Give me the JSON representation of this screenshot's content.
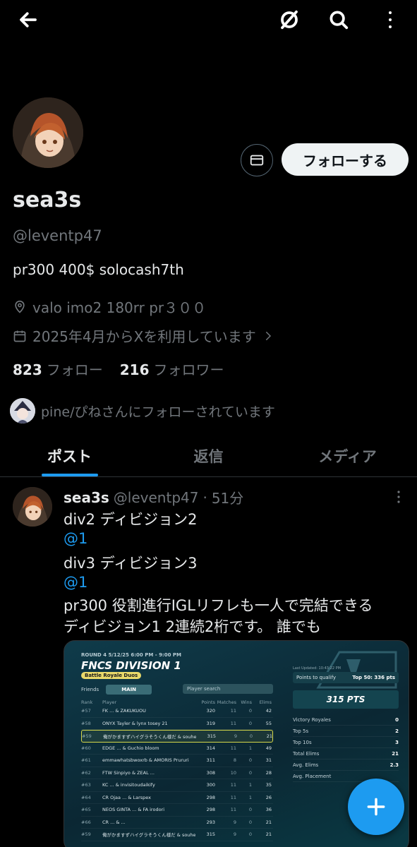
{
  "topbar": {
    "back_icon": "arrow-left-icon",
    "grok_icon": "grok-icon",
    "search_icon": "search-icon",
    "more_icon": "more-vertical-icon"
  },
  "profile": {
    "name": "sea3s",
    "handle": "@leventp47",
    "bio": "pr300 400$ solocash7th",
    "location": "valo imo2 180rr pr３００",
    "joined": "2025年4月からXを利用しています",
    "following_count": "823",
    "following_label": "フォロー",
    "followers_count": "216",
    "followers_label": "フォロワー",
    "followed_by": "pine/ぴねさんにフォローされています",
    "follow_button": "フォローする"
  },
  "tabs": [
    "ポスト",
    "返信",
    "メディア"
  ],
  "post": {
    "name": "sea3s",
    "handle": "@leventp47",
    "dot": "·",
    "time": "51分",
    "lines": [
      {
        "text": "div2  ディビジョン2",
        "type": "text"
      },
      {
        "text": "@1",
        "type": "mention"
      },
      {
        "text": "div3 ディビジョン3",
        "type": "text"
      },
      {
        "text": "@1",
        "type": "mention"
      },
      {
        "text": "pr300 役割進行IGLリフレも一人で完結できる",
        "type": "text"
      },
      {
        "text": "ディビジョン1 2連続2桁です。 誰でも",
        "type": "text"
      }
    ]
  },
  "media": {
    "round": "ROUND 4  5/12/25 6:00 PM - 9:00 PM",
    "title": "FNCS DIVISION 1",
    "mode": "Battle Royale  Duos",
    "friends": "Friends",
    "main": "MAIN",
    "search_placeholder": "Player search",
    "headers": {
      "rank": "Rank",
      "player": "Player",
      "points": "Points",
      "matches": "Matches",
      "wins": "Wins",
      "elims": "Elims"
    },
    "rows": [
      {
        "rank": "#57",
        "player": "FK ... & ZAKUKUOU",
        "points": "320",
        "matches": "11",
        "wins": "0",
        "elims": "42"
      },
      {
        "rank": "#58",
        "player": "ONYX Tayler & lynx tosey 21",
        "points": "319",
        "matches": "11",
        "wins": "0",
        "elims": "55"
      },
      {
        "rank": "#59",
        "player": "俺がかますずハイグラそうくん様だ & souhe Wingu",
        "points": "315",
        "matches": "9",
        "wins": "0",
        "elims": "21",
        "highlight": true
      },
      {
        "rank": "#60",
        "player": "EDGE ... & Guchio bloom",
        "points": "314",
        "matches": "11",
        "wins": "1",
        "elims": "49"
      },
      {
        "rank": "#61",
        "player": "emmawhatsbwoxrb & AMORIS Prururi",
        "points": "311",
        "matches": "8",
        "wins": "0",
        "elims": "31"
      },
      {
        "rank": "#62",
        "player": "FTW Sinpiyo & ZEAL ...",
        "points": "308",
        "matches": "10",
        "wins": "0",
        "elims": "28"
      },
      {
        "rank": "#63",
        "player": "KC ... & invisitoudaikify",
        "points": "300",
        "matches": "11",
        "wins": "1",
        "elims": "35"
      },
      {
        "rank": "#64",
        "player": "CR Ojaa ... & Larspex",
        "points": "298",
        "matches": "11",
        "wins": "1",
        "elims": "26"
      },
      {
        "rank": "#65",
        "player": "NEOS GINTA ... & FA irodori",
        "points": "298",
        "matches": "11",
        "wins": "0",
        "elims": "36"
      },
      {
        "rank": "#66",
        "player": "CR ... & ...",
        "points": "293",
        "matches": "9",
        "wins": "0",
        "elims": "21"
      },
      {
        "rank": "#59",
        "player": "俺がかますずハイグラそうくん様だ & souhe Wingu",
        "points": "315",
        "matches": "9",
        "wins": "0",
        "elims": "21"
      }
    ],
    "updated": "Last Updated: 10:43:22 PM",
    "qualify_label": "Points to qualify",
    "qualify_value": "Top 50: 336 pts",
    "pts": "315 PTS",
    "stats": [
      {
        "label": "Victory Royales",
        "value": "0"
      },
      {
        "label": "Top 5s",
        "value": "2"
      },
      {
        "label": "Top 10s",
        "value": "3"
      },
      {
        "label": "Total Elims",
        "value": "21"
      },
      {
        "label": "Avg. Elims",
        "value": "2.3"
      },
      {
        "label": "Avg. Placement",
        "value": ""
      }
    ]
  },
  "fab": {
    "icon": "plus-icon"
  },
  "colors": {
    "accent": "#1d9bf0",
    "background": "#000000",
    "muted": "#71767b"
  }
}
